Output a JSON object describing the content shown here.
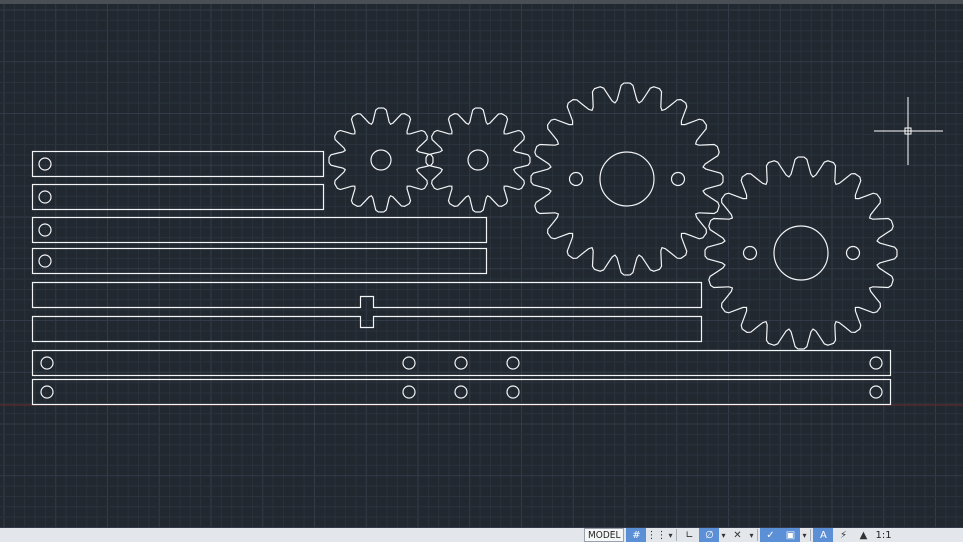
{
  "status_bar": {
    "model_label": "MODEL",
    "scale_label": "1:1",
    "buttons": [
      {
        "name": "grid-display-button",
        "icon": "grid-icon",
        "glyph": "#",
        "on": true
      },
      {
        "name": "snap-mode-button",
        "icon": "snap-dots-icon",
        "glyph": "⋮⋮",
        "on": false
      },
      {
        "name": "infer-constraints-button",
        "icon": "dropdown-icon",
        "glyph": "▾",
        "on": false
      },
      {
        "name": "ortho-mode-button",
        "icon": "ortho-icon",
        "glyph": "∟",
        "on": false
      },
      {
        "name": "polar-tracking-button",
        "icon": "polar-icon",
        "glyph": "∅",
        "on": true
      },
      {
        "name": "isodraft-button",
        "icon": "dropdown-icon",
        "glyph": "▾",
        "on": false
      },
      {
        "name": "object-snap-tracking-button",
        "icon": "tracking-icon",
        "glyph": "✕",
        "on": false
      },
      {
        "name": "object-snap-button",
        "icon": "dropdown-icon",
        "glyph": "▾",
        "on": false
      },
      {
        "name": "lineweight-button",
        "icon": "lineweight-icon",
        "glyph": "✓",
        "on": true
      },
      {
        "name": "selection-cycling-button",
        "icon": "selection-icon",
        "glyph": "▣",
        "on": true
      },
      {
        "name": "annotation-visibility-button",
        "icon": "dropdown-icon",
        "glyph": "▾",
        "on": false
      },
      {
        "name": "annotation-scale-button",
        "icon": "annotation-icon",
        "glyph": "A",
        "on": true
      },
      {
        "name": "autoscale-button",
        "icon": "autoscale-icon",
        "glyph": "⚡",
        "on": false
      },
      {
        "name": "annotation-monitor-button",
        "icon": "annotation-monitor-icon",
        "glyph": "▲",
        "on": false
      }
    ]
  },
  "colors": {
    "background": "#212830",
    "grid_minor": "#2a323c",
    "grid_major": "#323b47",
    "geometry": "#f2f4f6",
    "x_axis": "#6a2b2b",
    "status_bar": "#e3e6ea",
    "button_active": "#5b8fd6"
  }
}
